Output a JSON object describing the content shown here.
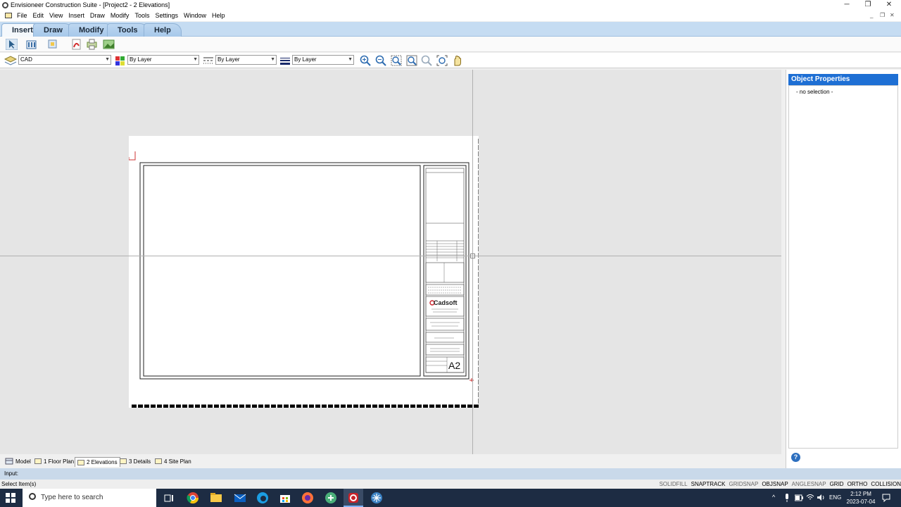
{
  "window": {
    "title": "Envisioneer Construction Suite - [Project2 - 2 Elevations]",
    "controls": [
      "─",
      "❐",
      "✕"
    ]
  },
  "menu": {
    "items": [
      "File",
      "Edit",
      "View",
      "Insert",
      "Draw",
      "Modify",
      "Tools",
      "Settings",
      "Window",
      "Help"
    ]
  },
  "ribbon": {
    "tabs": [
      "Insert",
      "Draw",
      "Modify",
      "Tools",
      "Help"
    ],
    "active_tab": "Insert"
  },
  "toolbar": {
    "icons": [
      "select-arrow-icon",
      "library-icon",
      "layer-manager-icon",
      "pdf-icon",
      "print-icon",
      "image-icon"
    ]
  },
  "layerbar": {
    "layer_value": "CAD",
    "color_value": "By Layer",
    "linestyle_value": "By Layer",
    "lineweight_value": "By Layer"
  },
  "zoom_tools": [
    "zoom-in-icon",
    "zoom-out-icon",
    "zoom-window-icon",
    "zoom-extents-icon",
    "zoom-previous-icon",
    "zoom-fit-icon",
    "pan-hand-icon"
  ],
  "title_block": {
    "brand": "Cadsoft",
    "sheet_number": "A2"
  },
  "properties": {
    "header": "Object Properties",
    "selection": "- no selection -",
    "help_label": "?"
  },
  "layout_tabs": [
    {
      "label": "Model"
    },
    {
      "label": "1 Floor Plan"
    },
    {
      "label": "2 Elevations"
    },
    {
      "label": "3 Details"
    },
    {
      "label": "4 Site Plan"
    }
  ],
  "command": {
    "input_label": "Input:",
    "status_text": "Select Item(s)"
  },
  "status_toggles": [
    {
      "label": "SOLIDFILL",
      "on": false
    },
    {
      "label": "SNAPTRACK",
      "on": true
    },
    {
      "label": "GRIDSNAP",
      "on": false
    },
    {
      "label": "OBJSNAP",
      "on": true
    },
    {
      "label": "ANGLESNAP",
      "on": false
    },
    {
      "label": "GRID",
      "on": true
    },
    {
      "label": "ORTHO",
      "on": true
    },
    {
      "label": "COLLISION",
      "on": true
    }
  ],
  "taskbar": {
    "search_placeholder": "Type here to search",
    "language": "ENG",
    "time": "2:12 PM",
    "date": "2023-07-04"
  }
}
